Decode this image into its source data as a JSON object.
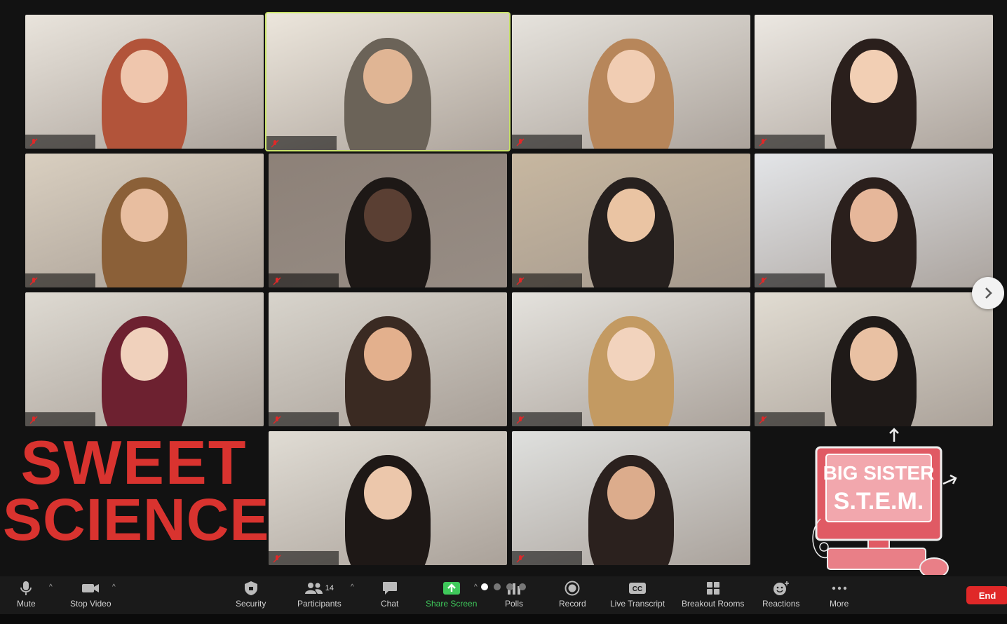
{
  "gallery": {
    "tiles": [
      {
        "id": "p1",
        "bg": "#e9e4dc",
        "person": "#b2543a",
        "face": "#efc6ad"
      },
      {
        "id": "p2",
        "bg": "#ece6dc",
        "person": "#6b6358",
        "face": "#e0b594",
        "active": true
      },
      {
        "id": "p3",
        "bg": "#e6e3dd",
        "person": "#b7865a",
        "face": "#f1cdb3"
      },
      {
        "id": "p4",
        "bg": "#ece8e2",
        "person": "#2a1f1c",
        "face": "#f2cfb4"
      },
      {
        "id": "p5",
        "bg": "#d9cfc0",
        "person": "#8b6038",
        "face": "#e8bea0"
      },
      {
        "id": "p6",
        "bg": "#8d8178",
        "person": "#1d1816",
        "face": "#5a3f33"
      },
      {
        "id": "p7",
        "bg": "#c7b7a0",
        "person": "#26201e",
        "face": "#eac4a3"
      },
      {
        "id": "p8",
        "bg": "#e3e5e8",
        "person": "#2a1f1c",
        "face": "#e6b79a"
      },
      {
        "id": "p9",
        "bg": "#dedad2",
        "person": "#6d2130",
        "face": "#f0d1bc"
      },
      {
        "id": "p10",
        "bg": "#d8d4cc",
        "person": "#3a2a22",
        "face": "#e3b08d"
      },
      {
        "id": "p11",
        "bg": "#e4e2dd",
        "person": "#c39a62",
        "face": "#f2d3bd"
      },
      {
        "id": "p12",
        "bg": "#e1dcd2",
        "person": "#1f1a18",
        "face": "#e9c1a3"
      },
      {
        "id": "p13",
        "bg": "#e0dcd4",
        "person": "#1e1816",
        "face": "#ecc7ab"
      },
      {
        "id": "p14",
        "bg": "#dfe0de",
        "person": "#2b211e",
        "face": "#dcac8c"
      }
    ]
  },
  "branding": {
    "title_line1": "SWEET",
    "title_line2": "SCIENCE",
    "logo_line1": "BIG SISTER",
    "logo_line2": "S.T.E.M."
  },
  "toolbar": {
    "mute": "Mute",
    "stop_video": "Stop Video",
    "security": "Security",
    "participants": "Participants",
    "participants_count": "14",
    "chat": "Chat",
    "share_screen": "Share Screen",
    "polls": "Polls",
    "record": "Record",
    "live_transcript": "Live Transcript",
    "live_transcript_icon_text": "CC",
    "breakout_rooms": "Breakout Rooms",
    "reactions": "Reactions",
    "more": "More",
    "end": "End"
  },
  "colors": {
    "accent_green": "#3fc95b",
    "end_red": "#e02828",
    "active_speaker": "#c9e26a",
    "title_red": "#d9332f"
  }
}
